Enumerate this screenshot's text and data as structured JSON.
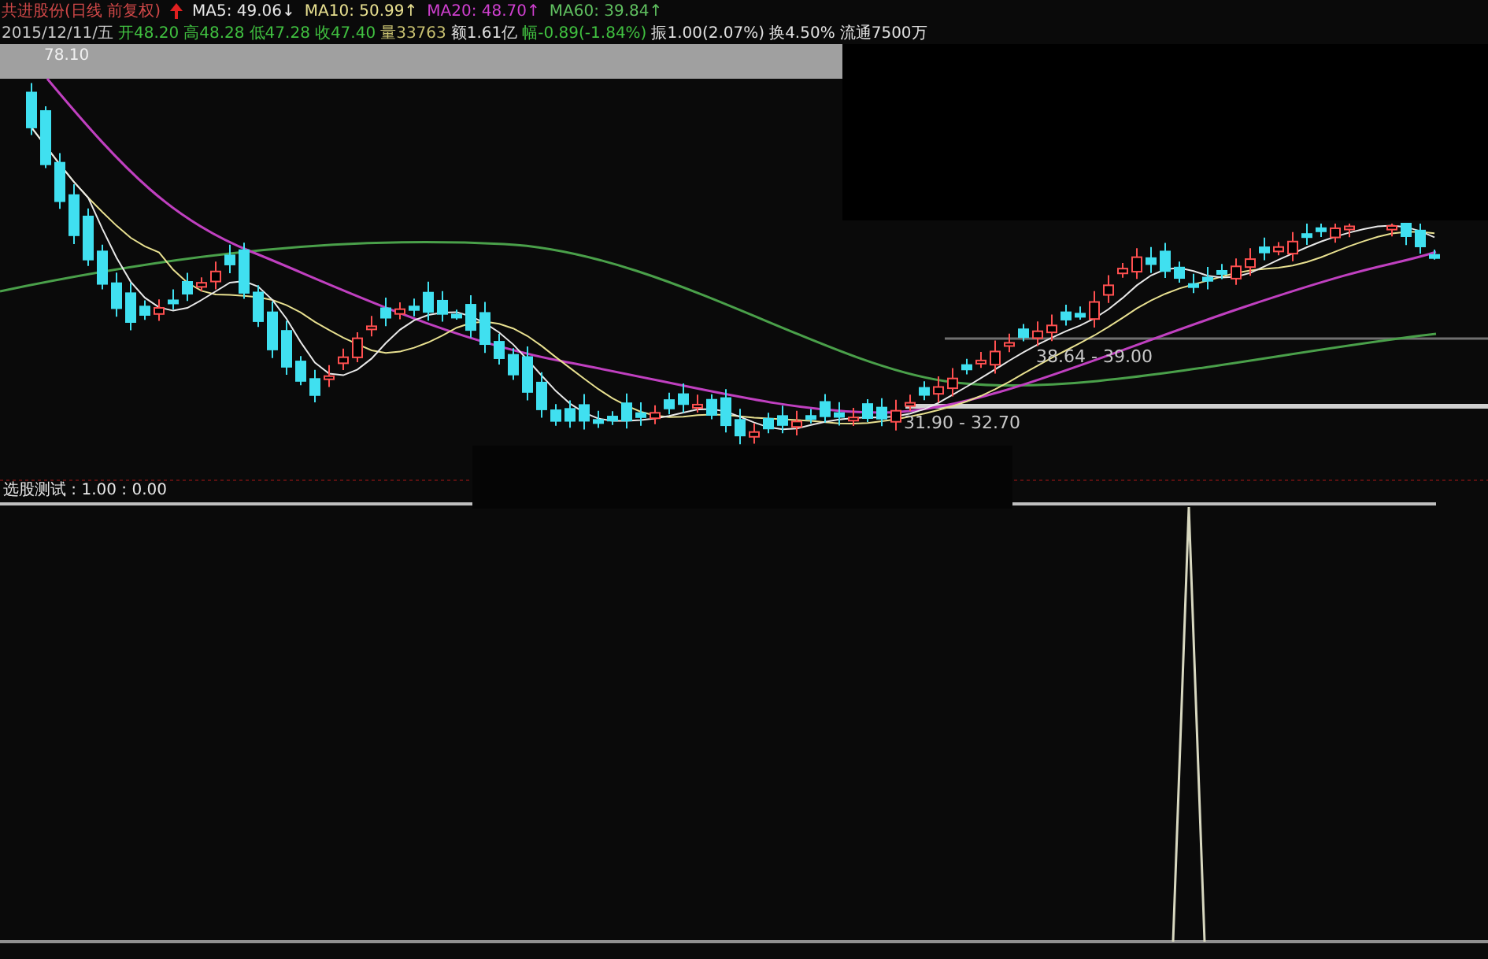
{
  "header": {
    "title": "共进股份(日线 前复权)",
    "ma": [
      {
        "label": "MA5: 49.06↓",
        "color": "#e8e8e8"
      },
      {
        "label": "MA10: 50.99↑",
        "color": "#e8e090"
      },
      {
        "label": "MA20: 48.70↑",
        "color": "#d040d0"
      },
      {
        "label": "MA60: 39.84↑",
        "color": "#60c060"
      }
    ]
  },
  "quote": [
    {
      "text": "2015/12/11/五",
      "color": "#c8c8c8"
    },
    {
      "text": "开48.20",
      "color": "#40c040"
    },
    {
      "text": "高48.28",
      "color": "#40c040"
    },
    {
      "text": "低47.28",
      "color": "#40c040"
    },
    {
      "text": "收47.40",
      "color": "#40c040"
    },
    {
      "text": "量33763",
      "color": "#c8c070"
    },
    {
      "text": "额1.61亿",
      "color": "#e0e0e0"
    },
    {
      "text": "幅-0.89(-1.84%)",
      "color": "#40c040"
    },
    {
      "text": "振1.00(2.07%)",
      "color": "#e0e0e0"
    },
    {
      "text": "换4.50%",
      "color": "#e0e0e0"
    },
    {
      "text": "流通7500万",
      "color": "#e0e0e0"
    }
  ],
  "chart": {
    "max_label": "78.10",
    "range_labels": [
      "38.64 - 39.00",
      "31.90 - 32.70"
    ]
  },
  "indicator": {
    "label": "选股测试 : 1.00 : 0.00"
  }
}
